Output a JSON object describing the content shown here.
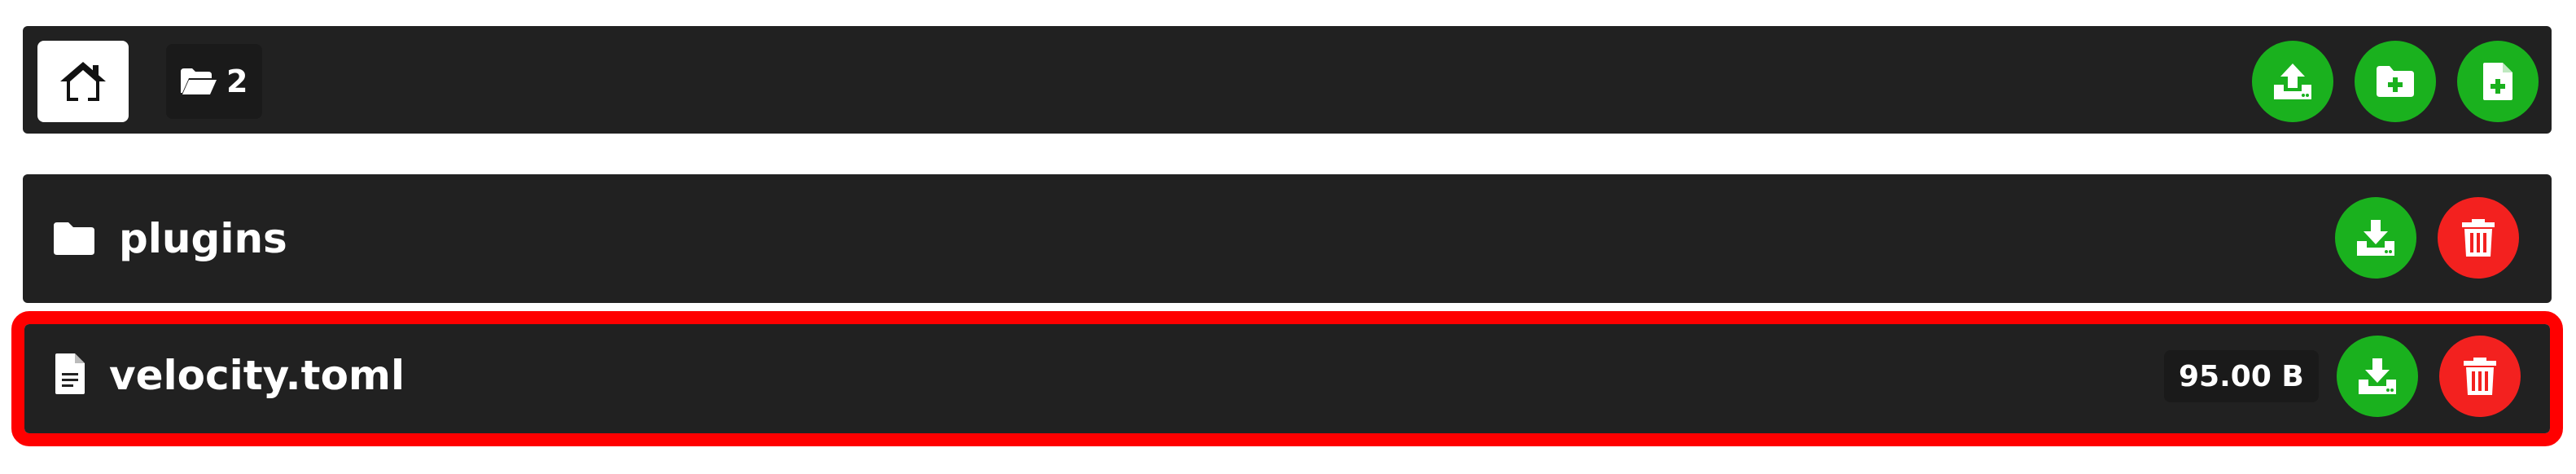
{
  "toolbar": {
    "home_icon": "home-icon",
    "breadcrumb_icon": "folder-open-icon",
    "breadcrumb_label": "2",
    "actions": [
      {
        "name": "upload-button",
        "icon": "upload-icon"
      },
      {
        "name": "new-folder-button",
        "icon": "folder-plus-icon"
      },
      {
        "name": "new-file-button",
        "icon": "file-plus-icon"
      }
    ]
  },
  "files": [
    {
      "type": "folder",
      "name": "plugins",
      "size": "",
      "icon": "folder-icon"
    },
    {
      "type": "file",
      "name": "velocity.toml",
      "size": "95.00 B",
      "icon": "file-text-icon",
      "highlighted": true
    }
  ],
  "colors": {
    "bar_bg": "#212121",
    "action_green": "#1ab11e",
    "delete_red": "#f3211f",
    "highlight_border": "#ff0000"
  }
}
